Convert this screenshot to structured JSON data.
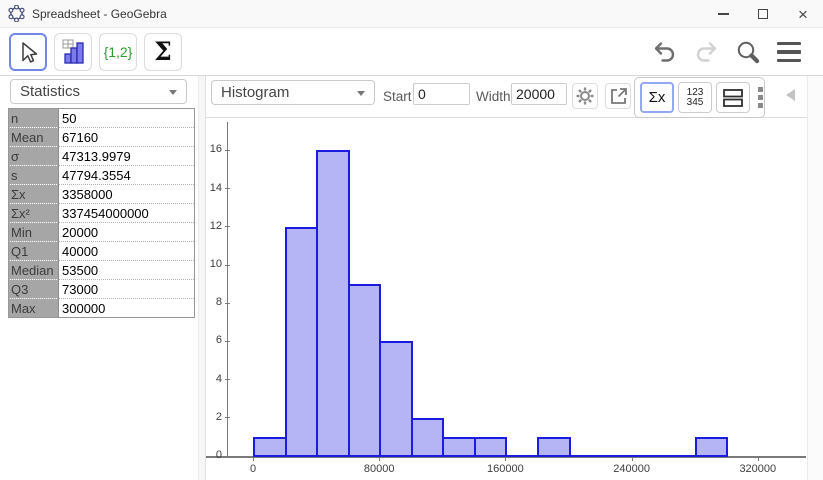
{
  "window": {
    "title": "Spreadsheet - GeoGebra",
    "close_glyph": "×"
  },
  "toolbar": {
    "list_tool_label": "{1,2}",
    "sum_tool_label": "Σ"
  },
  "stats_panel": {
    "selector_value": "Statistics",
    "table_rows": [
      {
        "label": "n",
        "value": "50"
      },
      {
        "label": "Mean",
        "value": "67160"
      },
      {
        "label": "σ",
        "value": "47313.9979"
      },
      {
        "label": "s",
        "value": "47794.3554"
      },
      {
        "label": "Σx",
        "value": "3358000"
      },
      {
        "label": "Σx²",
        "value": "337454000000"
      },
      {
        "label": "Min",
        "value": "20000"
      },
      {
        "label": "Q1",
        "value": "40000"
      },
      {
        "label": "Median",
        "value": "53500"
      },
      {
        "label": "Q3",
        "value": "73000"
      },
      {
        "label": "Max",
        "value": "300000"
      }
    ]
  },
  "chart_panel": {
    "type_selector_value": "Histogram",
    "start_label": "Start",
    "start_value": "0",
    "width_label": "Width",
    "width_value": "20000",
    "sigma_button_label": "Σx",
    "numbers_button_top": "123",
    "numbers_button_bottom": "345"
  },
  "chart_data": {
    "type": "bar",
    "subtype": "histogram",
    "title": "",
    "xlabel": "",
    "ylabel": "",
    "bin_width": 20000,
    "bin_starts": [
      0,
      20000,
      40000,
      60000,
      80000,
      100000,
      120000,
      140000,
      160000,
      180000,
      200000,
      220000,
      240000,
      260000,
      280000
    ],
    "counts": [
      1,
      12,
      16,
      9,
      6,
      2,
      1,
      1,
      0,
      1,
      0,
      0,
      0,
      0,
      1
    ],
    "x_tick_values": [
      0,
      80000,
      160000,
      240000,
      320000
    ],
    "x_tick_labels": [
      "0",
      "80000",
      "160000",
      "240000",
      "320000"
    ],
    "y_tick_values": [
      0,
      2,
      4,
      6,
      8,
      10,
      12,
      14,
      16
    ],
    "xlim": [
      -30000,
      350000
    ],
    "ylim": [
      0,
      17.6
    ],
    "grid": false,
    "legend": false,
    "bar_fill": "#b5b5f6",
    "bar_border": "#1c1ce0"
  }
}
